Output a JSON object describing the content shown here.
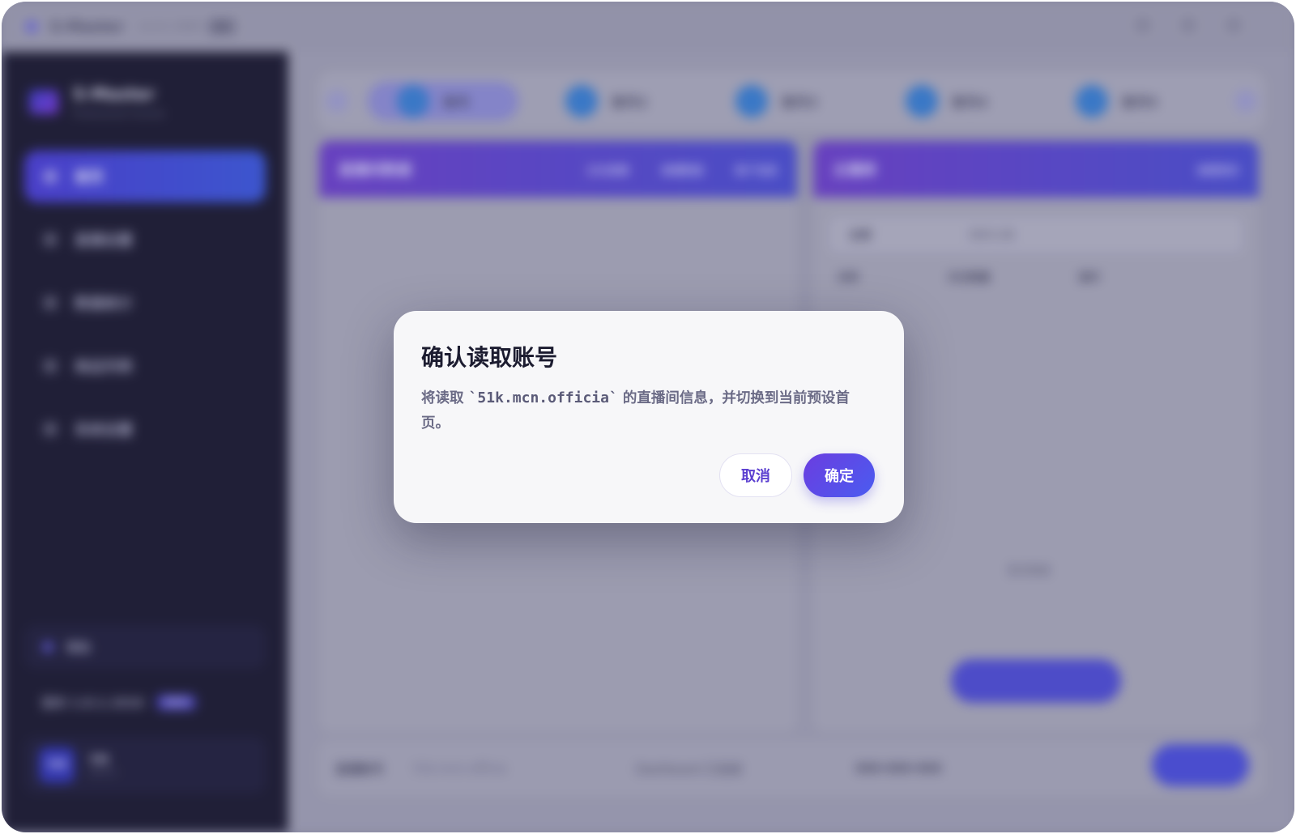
{
  "app": {
    "title": "S-Master",
    "version": "v1.0.1 2025",
    "tag": "测试",
    "subtitle": "Professional Console"
  },
  "sidebar": {
    "items": [
      {
        "label": "首页",
        "active": true
      },
      {
        "label": "直播设置"
      },
      {
        "label": "数据统计"
      },
      {
        "label": "商品列表"
      },
      {
        "label": "系统设置"
      }
    ],
    "bottom": {
      "label": "帮助"
    },
    "version_row": {
      "label": "版本 1.8.1.1016",
      "badge": "NEW"
    },
    "user": {
      "avatar": "YM",
      "name": "YM",
      "role": "Admin"
    }
  },
  "tabs": [
    {
      "label": "账号",
      "selected": true
    },
    {
      "label": "账号2"
    },
    {
      "label": "账号3"
    },
    {
      "label": "账号4"
    },
    {
      "label": "账号5"
    }
  ],
  "panels": {
    "left": {
      "title": "直播间数据",
      "links": [
        "正在直播",
        "直播数据",
        "账户信息"
      ]
    },
    "right": {
      "title": "主播库",
      "link": "查看更多",
      "filter": "全部",
      "search": "搜索主播",
      "columns": [
        "名称",
        "关注数量",
        "操作"
      ],
      "empty": "暂无数据",
      "button": "开始"
    }
  },
  "bottom_bar": {
    "label": "直播账号",
    "value": "51k.mcn.officia",
    "status": "Dashboard 已连接",
    "code": "888-888-888",
    "button": "开始直播"
  },
  "dialog": {
    "title": "确认读取账号",
    "body_prefix": "将读取 ",
    "account": "`51k.mcn.officia`",
    "body_suffix": " 的直播间信息，并切换到当前预设首页。",
    "cancel": "取消",
    "confirm": "确定"
  },
  "colors": {
    "accent": "#5b45e0",
    "sidebar_bg": "#1e1d35",
    "dialog_bg": "#f7f7f9"
  }
}
